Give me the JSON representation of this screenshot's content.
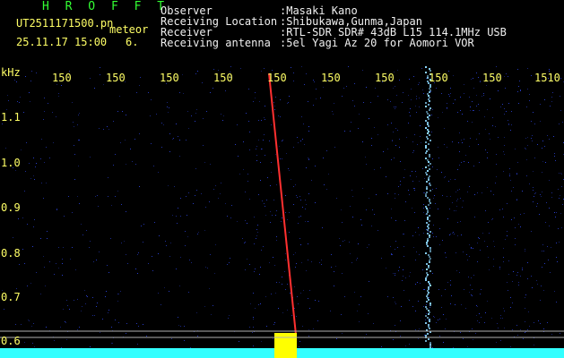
{
  "header": {
    "title": "H R O F F T",
    "filename": "UT2511171500.pn",
    "meteor_label": "meteor",
    "datetime": "25.11.17 15:00",
    "channel": "6.",
    "fields": [
      {
        "label": "Observer",
        "value": ":Masaki Kano"
      },
      {
        "label": "Receiving Location",
        "value": ":Shibukawa,Gunma,Japan"
      },
      {
        "label": "Receiver",
        "value": ":RTL-SDR SDR# 43dB L15 114.1MHz USB"
      },
      {
        "label": "Receiving antenna",
        "value": ":5el Yagi Az 20 for Aomori VOR"
      }
    ]
  },
  "axis": {
    "unit": "kHz",
    "freq_labels": [
      "150",
      "150",
      "150",
      "150",
      "150",
      "150",
      "150",
      "150",
      "150",
      "1510"
    ],
    "y_labels": [
      "1.1",
      "1.0",
      "0.9",
      "0.8",
      "0.7",
      "0.6"
    ]
  },
  "colors": {
    "background": "#000000",
    "noise": "#2a40d0",
    "carrier": "#8cd8ff",
    "trace": "#ff3030",
    "echo": "#ffff00",
    "baseline": "#33ffff"
  }
}
